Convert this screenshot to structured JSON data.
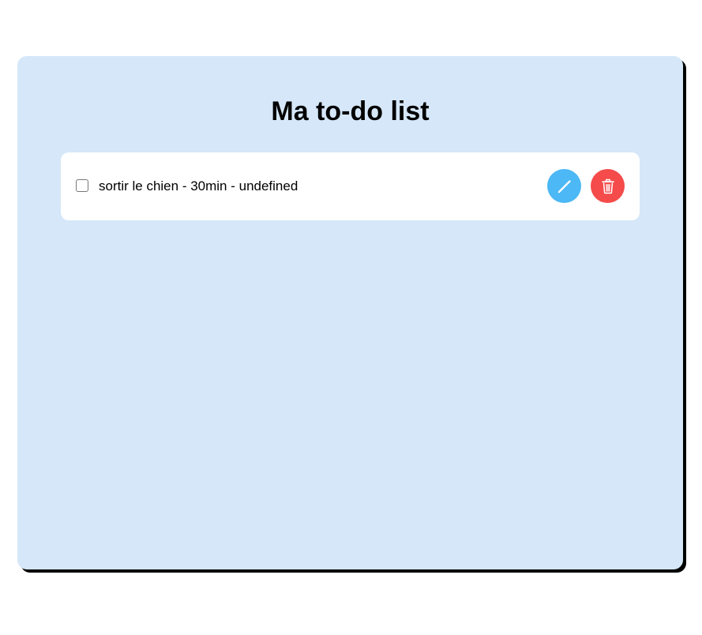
{
  "page": {
    "title": "Ma to-do list"
  },
  "tasks": [
    {
      "text": "sortir le chien - 30min - undefined",
      "done": false,
      "edit_icon": "pencil-icon",
      "delete_icon": "trash-icon"
    }
  ],
  "colors": {
    "card_background": "#d5e7f8",
    "edit_button": "#4cb8f5",
    "delete_button": "#f54b4b",
    "shadow": "#000000"
  }
}
